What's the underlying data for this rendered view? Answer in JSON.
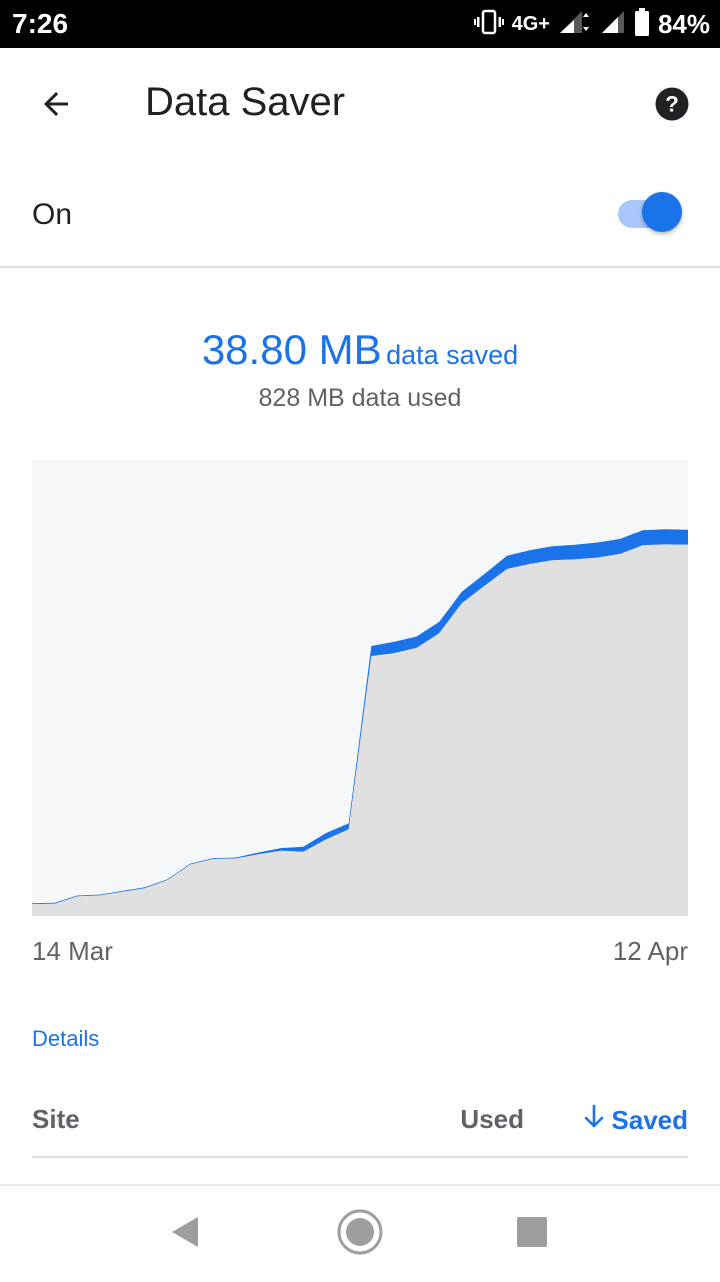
{
  "status_bar": {
    "time": "7:26",
    "network": "4G+",
    "battery": "84%",
    "icons": [
      "vibrate-icon",
      "signal-icon",
      "signal-icon",
      "battery-icon"
    ]
  },
  "app_bar": {
    "title": "Data Saver",
    "back_icon": "arrow-left-icon",
    "help_icon": "help-circle-icon"
  },
  "toggle": {
    "label": "On",
    "state": true
  },
  "summary": {
    "saved_amount": "38.80 MB",
    "saved_suffix": "data saved",
    "used": "828 MB data used"
  },
  "chart_data": {
    "type": "area",
    "x_start_label": "14 Mar",
    "x_end_label": "12 Apr",
    "x": [
      "14 Mar",
      "15 Mar",
      "16 Mar",
      "17 Mar",
      "18 Mar",
      "19 Mar",
      "20 Mar",
      "21 Mar",
      "22 Mar",
      "23 Mar",
      "24 Mar",
      "25 Mar",
      "26 Mar",
      "27 Mar",
      "28 Mar",
      "29 Mar",
      "30 Mar",
      "31 Mar",
      "1 Apr",
      "2 Apr",
      "3 Apr",
      "4 Apr",
      "5 Apr",
      "6 Apr",
      "7 Apr",
      "8 Apr",
      "9 Apr",
      "10 Apr",
      "11 Apr",
      "12 Apr"
    ],
    "series": [
      {
        "role": "used",
        "values": [
          2.6,
          2.7,
          4.3,
          4.5,
          5.3,
          6.1,
          7.9,
          11.3,
          12.5,
          12.6,
          13.5,
          14.3,
          14.1,
          16.8,
          19.0,
          57.0,
          57.6,
          58.8,
          62.0,
          68.6,
          72.4,
          76.1,
          77.2,
          78.0,
          78.2,
          78.6,
          79.4,
          81.3,
          81.5,
          81.4
        ],
        "color": "#e0e0e0"
      },
      {
        "role": "saved",
        "values": [
          0.2,
          0.2,
          0.2,
          0.2,
          0.2,
          0.2,
          0.2,
          0.2,
          0.2,
          0.2,
          0.4,
          0.6,
          1.1,
          1.4,
          1.3,
          2.2,
          2.5,
          2.5,
          2.5,
          2.5,
          2.6,
          2.9,
          3.0,
          3.1,
          3.2,
          3.3,
          3.3,
          3.3,
          3.3,
          3.3
        ],
        "color": "#1a73e8"
      }
    ],
    "ylim": [
      0,
      100
    ],
    "background": "#f6f7f8",
    "grid": false
  },
  "details": {
    "title": "Details",
    "columns": {
      "site": "Site",
      "used": "Used",
      "saved": "Saved"
    },
    "sort_icon": "arrow-down-icon"
  },
  "nav_bar": {
    "icons": [
      "nav-back-icon",
      "nav-home-icon",
      "nav-recents-icon"
    ]
  },
  "colors": {
    "accent": "#1a73e8",
    "text_primary": "#202124",
    "text_secondary": "#5f6368"
  }
}
